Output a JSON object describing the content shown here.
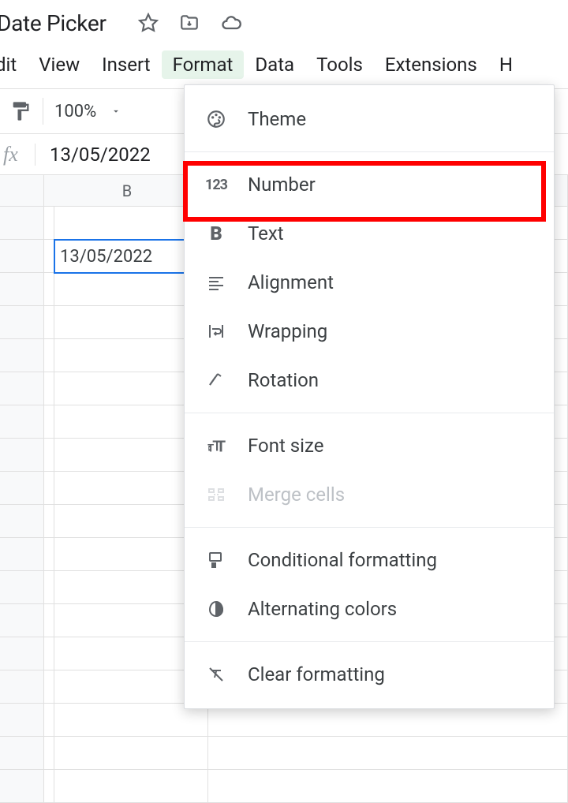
{
  "doc": {
    "title": "Date Picker"
  },
  "menu": {
    "edit": "dit",
    "view": "View",
    "insert": "Insert",
    "format": "Format",
    "data": "Data",
    "tools": "Tools",
    "extensions": "Extensions",
    "help": "H"
  },
  "toolbar": {
    "zoom": "100%"
  },
  "formula": {
    "value": "13/05/2022"
  },
  "columns": {
    "b": "B"
  },
  "cells": {
    "selected": "13/05/2022"
  },
  "format_menu": {
    "theme": "Theme",
    "number": "Number",
    "text": "Text",
    "alignment": "Alignment",
    "wrapping": "Wrapping",
    "rotation": "Rotation",
    "font_size": "Font size",
    "merge_cells": "Merge cells",
    "conditional_formatting": "Conditional formatting",
    "alternating_colors": "Alternating colors",
    "clear_formatting": "Clear formatting"
  }
}
